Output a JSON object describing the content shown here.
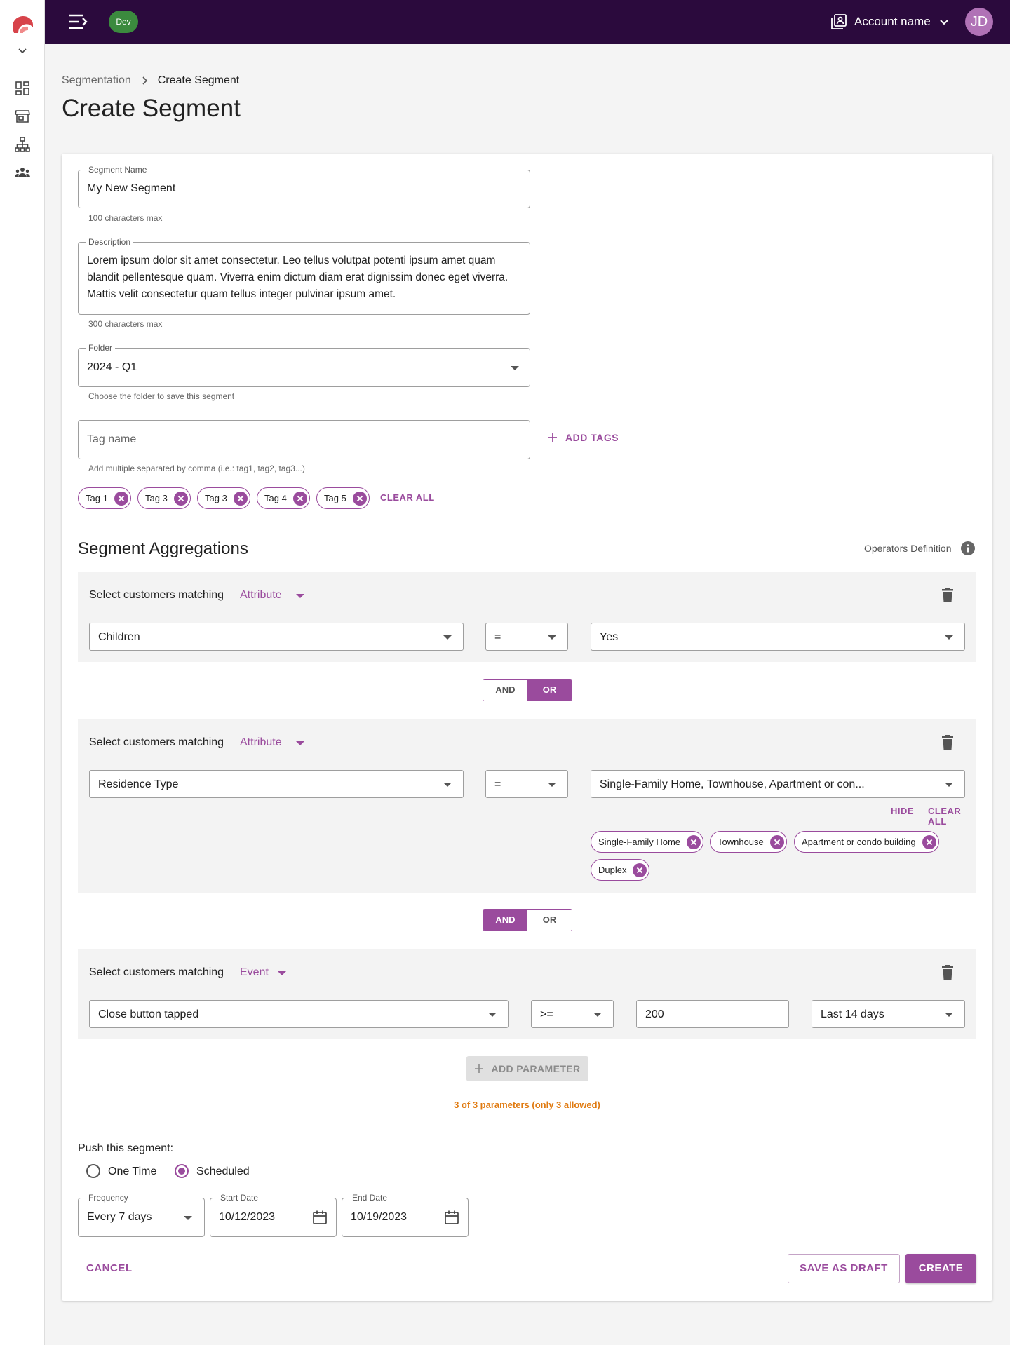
{
  "topbar": {
    "env_badge": "Dev",
    "account_name": "Account name",
    "avatar_initials": "JD"
  },
  "breadcrumb": {
    "parent": "Segmentation",
    "current": "Create Segment"
  },
  "page_title": "Create Segment",
  "form": {
    "segment_name": {
      "label": "Segment Name",
      "value": "My New Segment",
      "helper": "100 characters max"
    },
    "description": {
      "label": "Description",
      "value": "Lorem ipsum dolor sit amet consectetur. Leo tellus volutpat potenti ipsum amet quam blandit pellentesque quam. Viverra enim dictum diam erat dignissim donec eget viverra. Mattis velit consectetur quam tellus integer pulvinar ipsum amet.",
      "helper": "300 characters max"
    },
    "folder": {
      "label": "Folder",
      "value": "2024 - Q1",
      "helper": "Choose the folder to save this segment"
    },
    "tag_input": {
      "placeholder": "Tag name",
      "helper": "Add multiple separated by comma (i.e.: tag1, tag2, tag3...)",
      "add_label": "ADD TAGS"
    },
    "tags": [
      "Tag 1",
      "Tag 3",
      "Tag 3",
      "Tag 4",
      "Tag 5"
    ],
    "clear_all": "CLEAR ALL"
  },
  "aggregations": {
    "title": "Segment Aggregations",
    "operators_definition": "Operators Definition",
    "rule_label": "Select customers matching",
    "rules": [
      {
        "type": "Attribute",
        "field": "Children",
        "operator": "=",
        "value": "Yes"
      },
      {
        "type": "Attribute",
        "field": "Residence Type",
        "operator": "=",
        "value": "Single-Family Home, Townhouse, Apartment or con...",
        "hide": "HIDE",
        "clear_all": "CLEAR ALL",
        "chips": [
          "Single-Family Home",
          "Townhouse",
          "Apartment or condo building",
          "Duplex"
        ]
      },
      {
        "type": "Event",
        "field": "Close button tapped",
        "operator": ">=",
        "amount": "200",
        "period": "Last 14 days"
      }
    ],
    "joiners": [
      {
        "and": "AND",
        "or": "OR",
        "active": "OR"
      },
      {
        "and": "AND",
        "or": "OR",
        "active": "AND"
      }
    ],
    "add_parameter": "ADD PARAMETER",
    "limit_note": "3 of 3 parameters (only 3 allowed)"
  },
  "push": {
    "label": "Push this segment:",
    "options": [
      "One Time",
      "Scheduled"
    ],
    "selected": "Scheduled",
    "frequency": {
      "label": "Frequency",
      "value": "Every 7 days"
    },
    "start_date": {
      "label": "Start Date",
      "value": "10/12/2023"
    },
    "end_date": {
      "label": "End Date",
      "value": "10/19/2023"
    }
  },
  "actions": {
    "cancel": "CANCEL",
    "save_draft": "SAVE AS DRAFT",
    "create": "CREATE"
  },
  "colors": {
    "topbar": "#2b0a3d",
    "accent": "#9a4b9d",
    "env_badge": "#3b8a3e",
    "warning_text": "#e07a10"
  }
}
